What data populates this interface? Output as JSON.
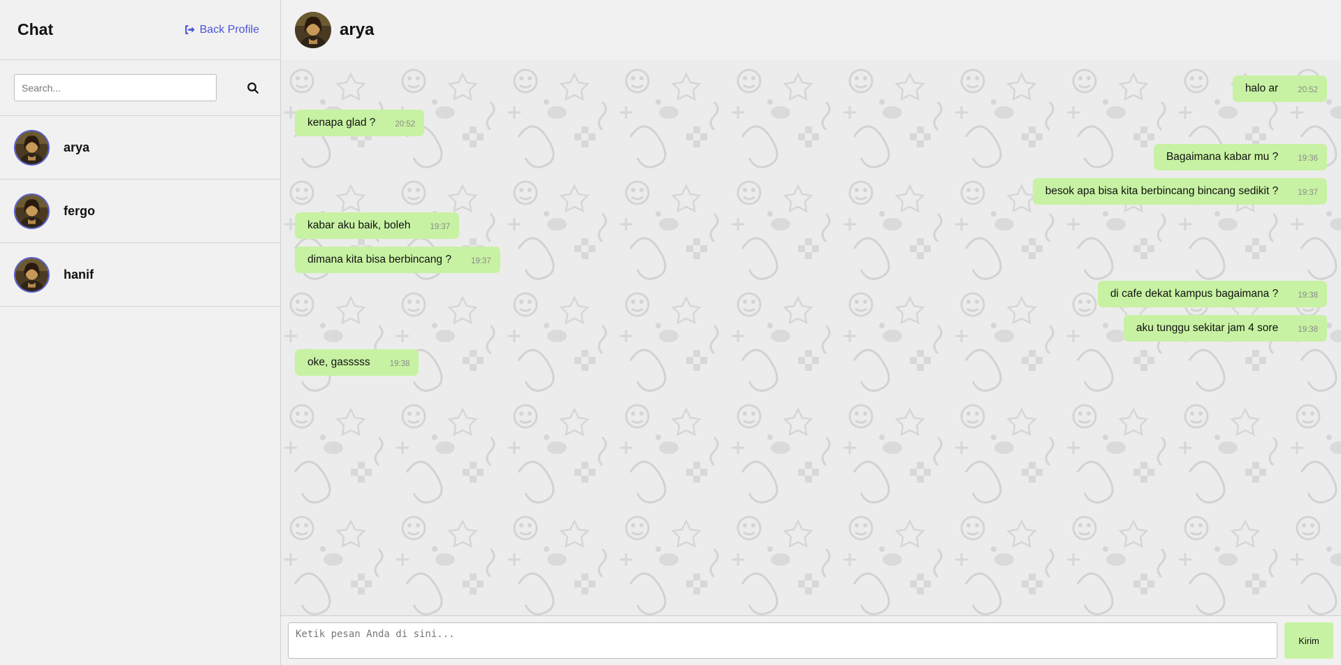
{
  "sidebar": {
    "title": "Chat",
    "back_label": "Back Profile",
    "search_placeholder": "Search...",
    "contacts": [
      {
        "name": "arya"
      },
      {
        "name": "fergo"
      },
      {
        "name": "hanif"
      }
    ]
  },
  "chat": {
    "contact_name": "arya",
    "messages": [
      {
        "dir": "out",
        "text": "halo ar",
        "time": "20:52"
      },
      {
        "dir": "in",
        "text": "kenapa glad ?",
        "time": "20:52"
      },
      {
        "dir": "out",
        "text": "Bagaimana kabar mu ?",
        "time": "19:36"
      },
      {
        "dir": "out",
        "text": "besok apa bisa kita berbincang bincang sedikit ?",
        "time": "19:37"
      },
      {
        "dir": "in",
        "text": "kabar aku baik, boleh",
        "time": "19:37"
      },
      {
        "dir": "in",
        "text": "dimana kita bisa berbincang ?",
        "time": "19:37"
      },
      {
        "dir": "out",
        "text": "di cafe dekat kampus bagaimana ?",
        "time": "19:38"
      },
      {
        "dir": "out",
        "text": "aku tunggu sekitar jam 4 sore",
        "time": "19:38"
      },
      {
        "dir": "in",
        "text": "oke, gasssss",
        "time": "19:38"
      }
    ],
    "composer_placeholder": "Ketik pesan Anda di sini...",
    "send_label": "Kirim"
  },
  "colors": {
    "accent_link": "#4a54d6",
    "bubble": "#c8f2a3",
    "panel": "#f1f1f1"
  },
  "icons": {
    "back": "sign-out-icon",
    "search": "search-icon"
  }
}
